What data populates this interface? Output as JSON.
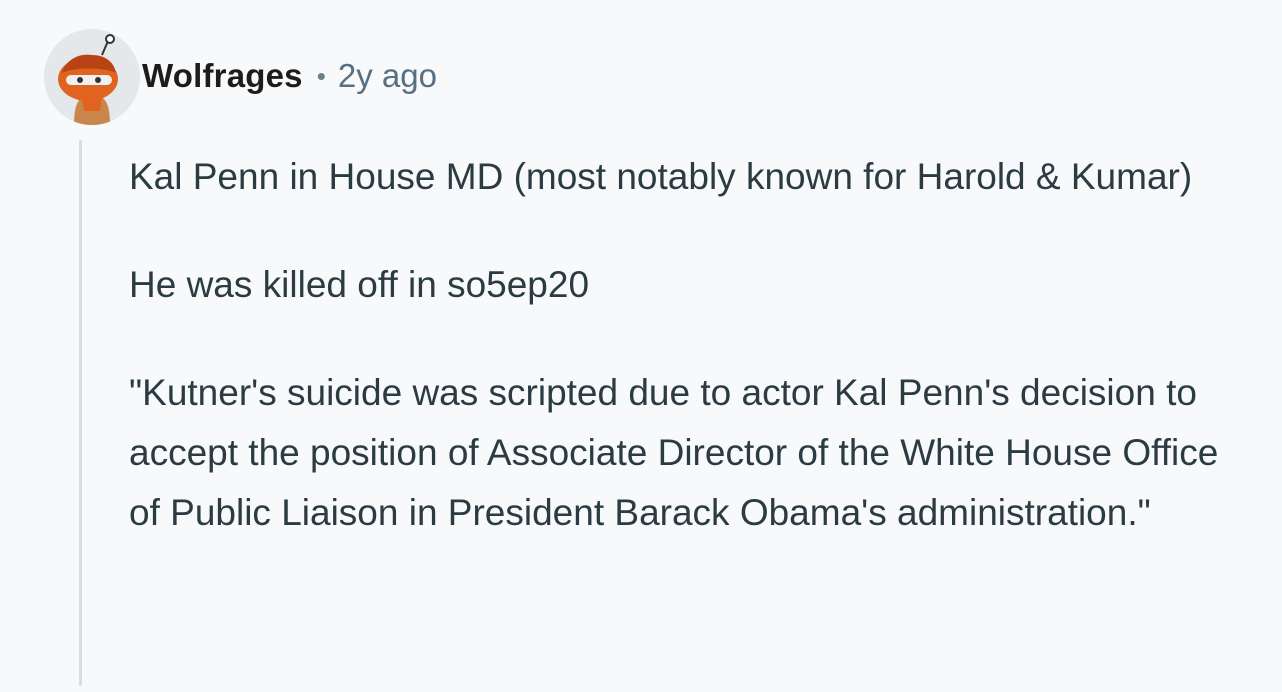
{
  "comment": {
    "author": "Wolfrages",
    "separator": "•",
    "timestamp": "2y ago",
    "avatar_icon": "snoo-avatar-icon",
    "paragraphs": [
      "Kal Penn in House MD (most notably known for Harold & Kumar)",
      "He was killed off in so5ep20",
      "\"Kutner's suicide was scripted due to actor Kal Penn's decision to accept the position of Associate Director of the White House Office of Public Liaison in President Barack Obama's administration.\""
    ]
  },
  "colors": {
    "background": "#f8f9fa",
    "username": "#1c1c1c",
    "meta": "#576f82",
    "body_text": "#2a3c42",
    "thread_line": "#d6dde3"
  }
}
